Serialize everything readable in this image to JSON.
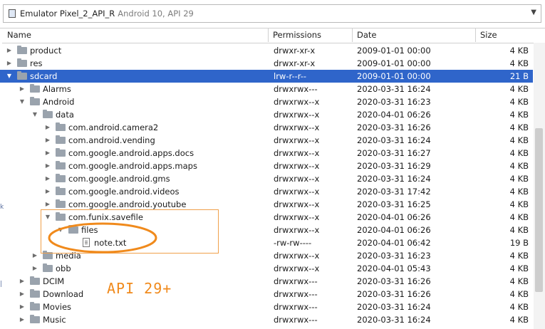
{
  "device": {
    "name": "Emulator Pixel_2_API_R",
    "details": "Android 10, API 29",
    "icon": "device-icon",
    "dropdown_icon": "chevron-down-icon"
  },
  "columns": {
    "name": "Name",
    "permissions": "Permissions",
    "date": "Date",
    "size": "Size"
  },
  "rows": [
    {
      "name": "product",
      "type": "folder",
      "depth": 0,
      "expanded": false,
      "perm": "drwxr-xr-x",
      "date": "2009-01-01 00:00",
      "size": "4 KB"
    },
    {
      "name": "res",
      "type": "folder",
      "depth": 0,
      "expanded": false,
      "perm": "drwxr-xr-x",
      "date": "2009-01-01 00:00",
      "size": "4 KB"
    },
    {
      "name": "sdcard",
      "type": "folder",
      "depth": 0,
      "expanded": true,
      "selected": true,
      "perm": "lrw-r--r--",
      "date": "2009-01-01 00:00",
      "size": "21 B"
    },
    {
      "name": "Alarms",
      "type": "folder",
      "depth": 1,
      "expanded": false,
      "perm": "drwxrwx---",
      "date": "2020-03-31 16:24",
      "size": "4 KB"
    },
    {
      "name": "Android",
      "type": "folder",
      "depth": 1,
      "expanded": true,
      "perm": "drwxrwx--x",
      "date": "2020-03-31 16:23",
      "size": "4 KB"
    },
    {
      "name": "data",
      "type": "folder",
      "depth": 2,
      "expanded": true,
      "perm": "drwxrwx--x",
      "date": "2020-04-01 06:26",
      "size": "4 KB"
    },
    {
      "name": "com.android.camera2",
      "type": "folder",
      "depth": 3,
      "expanded": false,
      "perm": "drwxrwx--x",
      "date": "2020-03-31 16:26",
      "size": "4 KB"
    },
    {
      "name": "com.android.vending",
      "type": "folder",
      "depth": 3,
      "expanded": false,
      "perm": "drwxrwx--x",
      "date": "2020-03-31 16:24",
      "size": "4 KB"
    },
    {
      "name": "com.google.android.apps.docs",
      "type": "folder",
      "depth": 3,
      "expanded": false,
      "perm": "drwxrwx--x",
      "date": "2020-03-31 16:27",
      "size": "4 KB"
    },
    {
      "name": "com.google.android.apps.maps",
      "type": "folder",
      "depth": 3,
      "expanded": false,
      "perm": "drwxrwx--x",
      "date": "2020-03-31 16:29",
      "size": "4 KB"
    },
    {
      "name": "com.google.android.gms",
      "type": "folder",
      "depth": 3,
      "expanded": false,
      "perm": "drwxrwx--x",
      "date": "2020-03-31 16:24",
      "size": "4 KB"
    },
    {
      "name": "com.google.android.videos",
      "type": "folder",
      "depth": 3,
      "expanded": false,
      "perm": "drwxrwx--x",
      "date": "2020-03-31 17:42",
      "size": "4 KB"
    },
    {
      "name": "com.google.android.youtube",
      "type": "folder",
      "depth": 3,
      "expanded": false,
      "perm": "drwxrwx--x",
      "date": "2020-03-31 16:25",
      "size": "4 KB"
    },
    {
      "name": "com.funix.savefile",
      "type": "folder",
      "depth": 3,
      "expanded": true,
      "perm": "drwxrwx--x",
      "date": "2020-04-01 06:26",
      "size": "4 KB"
    },
    {
      "name": "files",
      "type": "folder",
      "depth": 4,
      "expanded": true,
      "perm": "drwxrwx--x",
      "date": "2020-04-01 06:26",
      "size": "4 KB"
    },
    {
      "name": "note.txt",
      "type": "file",
      "depth": 5,
      "perm": "-rw-rw----",
      "date": "2020-04-01 06:42",
      "size": "19 B"
    },
    {
      "name": "media",
      "type": "folder",
      "depth": 2,
      "expanded": false,
      "perm": "drwxrwx--x",
      "date": "2020-03-31 16:23",
      "size": "4 KB"
    },
    {
      "name": "obb",
      "type": "folder",
      "depth": 2,
      "expanded": false,
      "perm": "drwxrwx--x",
      "date": "2020-04-01 05:43",
      "size": "4 KB"
    },
    {
      "name": "DCIM",
      "type": "folder",
      "depth": 1,
      "expanded": false,
      "perm": "drwxrwx---",
      "date": "2020-03-31 16:26",
      "size": "4 KB"
    },
    {
      "name": "Download",
      "type": "folder",
      "depth": 1,
      "expanded": false,
      "perm": "drwxrwx---",
      "date": "2020-03-31 16:26",
      "size": "4 KB"
    },
    {
      "name": "Movies",
      "type": "folder",
      "depth": 1,
      "expanded": false,
      "perm": "drwxrwx---",
      "date": "2020-03-31 16:24",
      "size": "4 KB"
    },
    {
      "name": "Music",
      "type": "folder",
      "depth": 1,
      "expanded": false,
      "perm": "drwxrwx---",
      "date": "2020-03-31 16:24",
      "size": "4 KB"
    }
  ],
  "annotation": {
    "label": "API 29+",
    "color": "#f08a1c"
  },
  "colors": {
    "selection": "#2f65ca",
    "folder": "#9aa3ad"
  }
}
